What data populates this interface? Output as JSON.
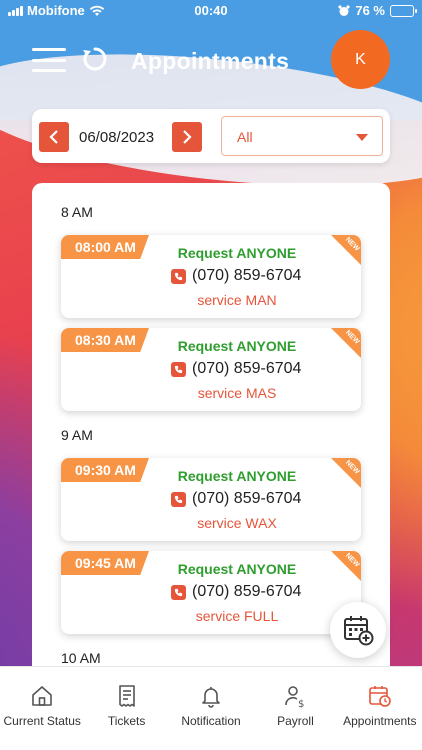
{
  "status_bar": {
    "carrier": "Mobifone",
    "time": "00:40",
    "battery": "76 %",
    "battery_level": 0.76
  },
  "header": {
    "title": "Appointments",
    "avatar_initial": "K"
  },
  "filter": {
    "date": "06/08/2023",
    "selected": "All"
  },
  "groups": [
    {
      "hour": "8 AM",
      "appointments": [
        {
          "time": "08:00 AM",
          "request": "Request ANYONE",
          "phone": "(070) 859-6704",
          "service": "service MAN",
          "badge": "NEW"
        },
        {
          "time": "08:30 AM",
          "request": "Request ANYONE",
          "phone": "(070) 859-6704",
          "service": "service MAS",
          "badge": "NEW"
        }
      ]
    },
    {
      "hour": "9 AM",
      "appointments": [
        {
          "time": "09:30 AM",
          "request": "Request ANYONE",
          "phone": "(070) 859-6704",
          "service": "service WAX",
          "badge": "NEW"
        },
        {
          "time": "09:45 AM",
          "request": "Request ANYONE",
          "phone": "(070) 859-6704",
          "service": "service FULL",
          "badge": "NEW"
        }
      ]
    },
    {
      "hour": "10 AM",
      "appointments": []
    }
  ],
  "nav": [
    {
      "label": "Current Status",
      "icon": "home-icon"
    },
    {
      "label": "Tickets",
      "icon": "receipt-icon"
    },
    {
      "label": "Notification",
      "icon": "bell-icon"
    },
    {
      "label": "Payroll",
      "icon": "person-dollar-icon"
    },
    {
      "label": "Appointments",
      "icon": "calendar-clock-icon"
    }
  ],
  "colors": {
    "accent": "#e5553a",
    "tag": "#f79446",
    "request_green": "#2f9e2f",
    "avatar": "#f26a22"
  }
}
